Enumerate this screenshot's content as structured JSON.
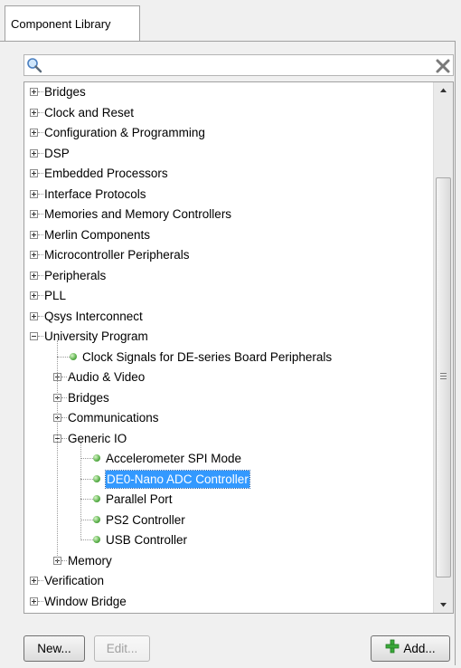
{
  "tab": {
    "label": "Component Library"
  },
  "search": {
    "value": "",
    "search_icon": "search-icon",
    "clear_icon": "close-icon"
  },
  "tree": {
    "items": [
      {
        "label": "Bridges",
        "depth": 0,
        "toggle": "plus"
      },
      {
        "label": "Clock and Reset",
        "depth": 0,
        "toggle": "plus"
      },
      {
        "label": "Configuration & Programming",
        "depth": 0,
        "toggle": "plus"
      },
      {
        "label": "DSP",
        "depth": 0,
        "toggle": "plus"
      },
      {
        "label": "Embedded Processors",
        "depth": 0,
        "toggle": "plus"
      },
      {
        "label": "Interface Protocols",
        "depth": 0,
        "toggle": "plus"
      },
      {
        "label": "Memories and Memory Controllers",
        "depth": 0,
        "toggle": "plus"
      },
      {
        "label": "Merlin Components",
        "depth": 0,
        "toggle": "plus"
      },
      {
        "label": "Microcontroller Peripherals",
        "depth": 0,
        "toggle": "plus"
      },
      {
        "label": "Peripherals",
        "depth": 0,
        "toggle": "plus"
      },
      {
        "label": "PLL",
        "depth": 0,
        "toggle": "plus"
      },
      {
        "label": "Qsys Interconnect",
        "depth": 0,
        "toggle": "plus"
      },
      {
        "label": "University Program",
        "depth": 0,
        "toggle": "minus"
      },
      {
        "label": "Clock Signals for DE-series Board Peripherals",
        "depth": 1,
        "toggle": "leaf"
      },
      {
        "label": "Audio & Video",
        "depth": 1,
        "toggle": "plus"
      },
      {
        "label": "Bridges",
        "depth": 1,
        "toggle": "plus"
      },
      {
        "label": "Communications",
        "depth": 1,
        "toggle": "plus"
      },
      {
        "label": "Generic IO",
        "depth": 1,
        "toggle": "minus"
      },
      {
        "label": "Accelerometer SPI Mode",
        "depth": 2,
        "toggle": "leaf"
      },
      {
        "label": "DE0-Nano ADC Controller",
        "depth": 2,
        "toggle": "leaf",
        "selected": true
      },
      {
        "label": "Parallel Port",
        "depth": 2,
        "toggle": "leaf"
      },
      {
        "label": "PS2 Controller",
        "depth": 2,
        "toggle": "leaf"
      },
      {
        "label": "USB Controller",
        "depth": 2,
        "toggle": "leaf"
      },
      {
        "label": "Memory",
        "depth": 1,
        "toggle": "plus"
      },
      {
        "label": "Verification",
        "depth": 0,
        "toggle": "plus"
      },
      {
        "label": "Window Bridge",
        "depth": 0,
        "toggle": "plus"
      }
    ]
  },
  "buttons": {
    "new_label": "New...",
    "edit_label": "Edit...",
    "add_label": "Add..."
  },
  "colors": {
    "selection": "#3399ff",
    "leaf_dot": "#5ab04a",
    "add_icon": "#3aa83a"
  }
}
